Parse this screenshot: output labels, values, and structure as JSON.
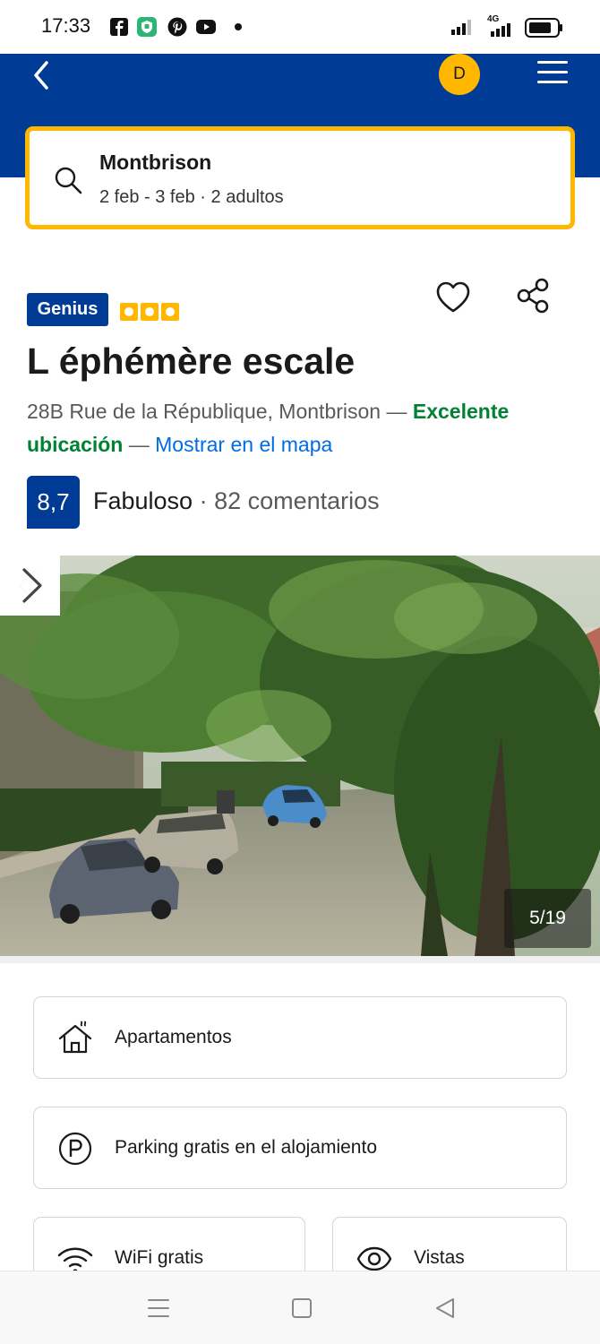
{
  "status_bar": {
    "time": "17:33",
    "notification_icons": [
      "facebook-icon",
      "shield-app-icon",
      "pinterest-icon",
      "youtube-icon"
    ],
    "network": "4G",
    "icons": [
      "signal-icon",
      "signal-4g-icon",
      "battery-icon"
    ]
  },
  "header": {
    "avatar_initial": "D",
    "colors": {
      "brand_blue": "#003b95",
      "accent_yellow": "#ffb700"
    }
  },
  "search": {
    "destination": "Montbrison",
    "dates_guests": "2 feb - 3 feb · 2 adultos"
  },
  "property": {
    "genius_label": "Genius",
    "rating_squares": 3,
    "name": "L éphémère escale",
    "address": "28B Rue de la République, Montbrison",
    "dash1": " — ",
    "location_highlight": "Excelente ubicación",
    "dash2": " — ",
    "map_link": "Mostrar en el mapa",
    "score": "8,7",
    "score_label": "Fabuloso",
    "separator": " · ",
    "reviews": "82 comentarios"
  },
  "gallery": {
    "counter": "5/19"
  },
  "facilities": [
    {
      "label": "Apartamentos",
      "icon": "house-icon"
    },
    {
      "label": "Parking gratis en el alojamiento",
      "icon": "parking-icon"
    },
    {
      "label": "WiFi gratis",
      "icon": "wifi-icon"
    },
    {
      "label": "Vistas",
      "icon": "eye-icon"
    }
  ],
  "nav": {
    "icons": [
      "menu-nav-icon",
      "home-nav-icon",
      "back-nav-icon"
    ]
  }
}
